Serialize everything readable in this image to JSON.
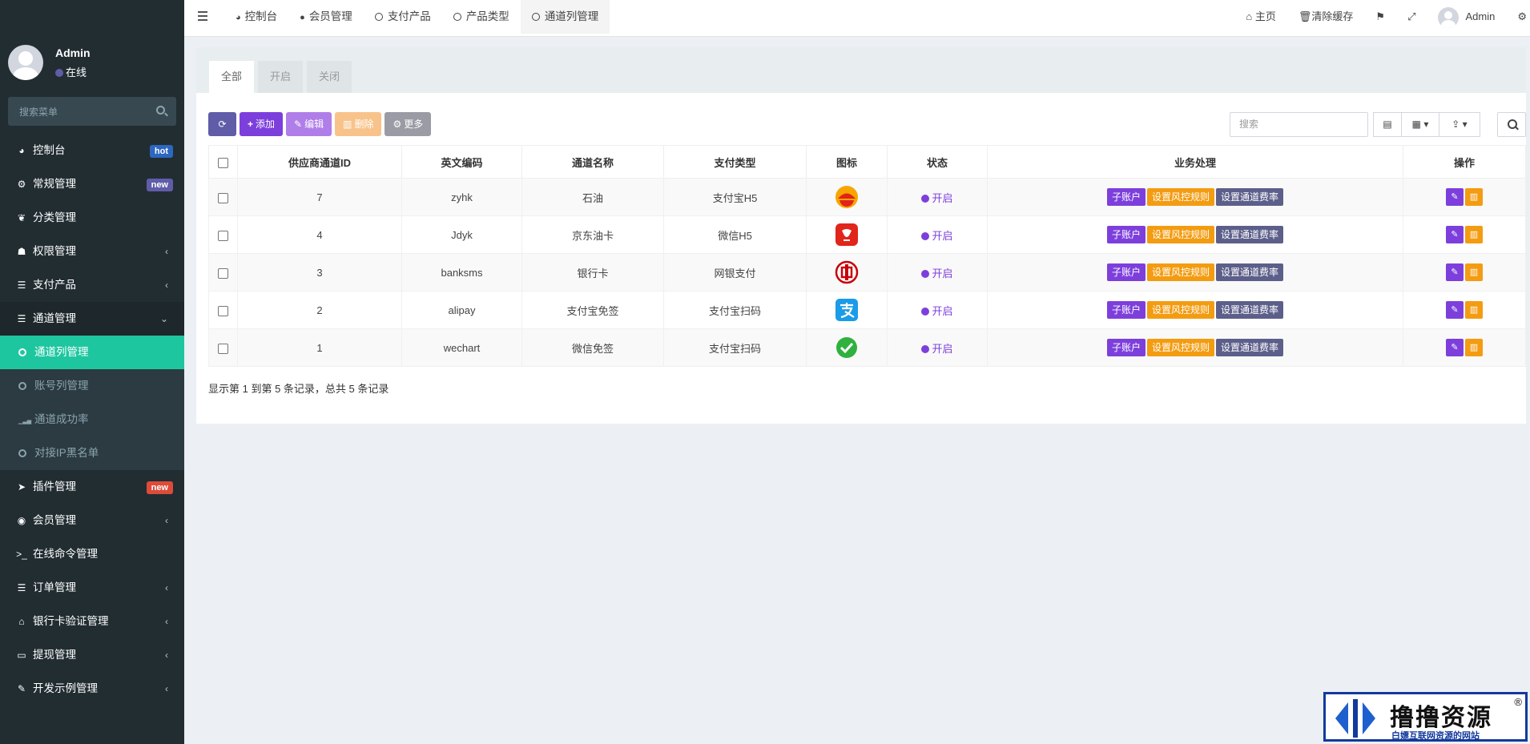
{
  "sidebar": {
    "user": {
      "name": "Admin",
      "status": "在线"
    },
    "search_placeholder": "搜索菜单",
    "items": [
      {
        "label": "控制台",
        "icon": "dashboard-icon",
        "glyph": "◕",
        "badge": "hot",
        "badge_color": "#2c67c0"
      },
      {
        "label": "常规管理",
        "icon": "cogs-icon",
        "glyph": "⚙",
        "badge": "new",
        "badge_color": "#605ca8"
      },
      {
        "label": "分类管理",
        "icon": "leaf-icon",
        "glyph": "❦"
      },
      {
        "label": "权限管理",
        "icon": "group-icon",
        "glyph": "☗",
        "arrow": "‹"
      },
      {
        "label": "支付产品",
        "icon": "list-icon",
        "glyph": "☰",
        "arrow": "‹"
      },
      {
        "label": "通道管理",
        "icon": "list-icon",
        "glyph": "☰",
        "arrow": "⌄"
      },
      {
        "label": "通道列管理",
        "sub": true,
        "active": true
      },
      {
        "label": "账号列管理",
        "sub": true
      },
      {
        "label": "通道成功率",
        "sub": true,
        "icon": "signal-icon",
        "glyph": "▁▃▅"
      },
      {
        "label": "对接IP黑名单",
        "sub": true
      },
      {
        "label": "插件管理",
        "icon": "rocket-icon",
        "glyph": "➤",
        "badge": "new",
        "badge_color": "#dd4b39"
      },
      {
        "label": "会员管理",
        "icon": "user-circle-icon",
        "glyph": "◉",
        "arrow": "‹"
      },
      {
        "label": "在线命令管理",
        "icon": "terminal-icon",
        "glyph": ">_"
      },
      {
        "label": "订单管理",
        "icon": "list-icon",
        "glyph": "☰",
        "arrow": "‹"
      },
      {
        "label": "银行卡验证管理",
        "icon": "bank-icon",
        "glyph": "⌂",
        "arrow": "‹"
      },
      {
        "label": "提现管理",
        "icon": "visa-card-icon",
        "glyph": "▭",
        "arrow": "‹"
      },
      {
        "label": "开发示例管理",
        "icon": "magic-icon",
        "glyph": "✎",
        "arrow": "‹"
      }
    ]
  },
  "topbar": {
    "tabs": [
      {
        "label": "控制台",
        "icon": "dashboard-icon",
        "glyph": "◕"
      },
      {
        "label": "会员管理",
        "icon": "user-icon",
        "glyph": "●"
      },
      {
        "label": "支付产品",
        "icon": "circle-icon"
      },
      {
        "label": "产品类型",
        "icon": "circle-icon"
      },
      {
        "label": "通道列管理",
        "icon": "circle-icon",
        "active": true
      }
    ],
    "right": {
      "home": "主页",
      "clear_cache": "清除缓存",
      "admin": "Admin"
    }
  },
  "content": {
    "filter_tabs": [
      "全部",
      "开启",
      "关闭"
    ],
    "toolbar": {
      "add": "添加",
      "edit": "编辑",
      "delete": "删除",
      "more": "更多"
    },
    "search_placeholder": "搜索",
    "columns": [
      "供应商通道ID",
      "英文编码",
      "通道名称",
      "支付类型",
      "图标",
      "状态",
      "业务处理",
      "操作"
    ],
    "rows": [
      {
        "id": "7",
        "code": "zyhk",
        "name": "石油",
        "pay_type": "支付宝H5",
        "icon": "petrochina-icon",
        "status": "开启"
      },
      {
        "id": "4",
        "code": "Jdyk",
        "name": "京东油卡",
        "pay_type": "微信H5",
        "icon": "jd-icon",
        "status": "开启"
      },
      {
        "id": "3",
        "code": "banksms",
        "name": "银行卡",
        "pay_type": "网银支付",
        "icon": "icbc-icon",
        "status": "开启"
      },
      {
        "id": "2",
        "code": "alipay",
        "name": "支付宝免签",
        "pay_type": "支付宝扫码",
        "icon": "alipay-icon",
        "status": "开启"
      },
      {
        "id": "1",
        "code": "wechart",
        "name": "微信免签",
        "pay_type": "支付宝扫码",
        "icon": "wechat-icon",
        "status": "开启"
      }
    ],
    "row_actions": {
      "sub_account": "子账户",
      "risk_rules": "设置风控规则",
      "channel_rate": "设置通道费率"
    },
    "page_info": "显示第 1 到第 5 条记录，总共 5 条记录"
  },
  "watermark": {
    "title": "撸撸资源",
    "subtitle": "白嫖互联网资源的网站",
    "reg": "®"
  },
  "colors": {
    "sidebar_bg": "#222d32",
    "active_green": "#1ec6a0",
    "purple": "#7d3fdc",
    "orange": "#f39c12"
  }
}
